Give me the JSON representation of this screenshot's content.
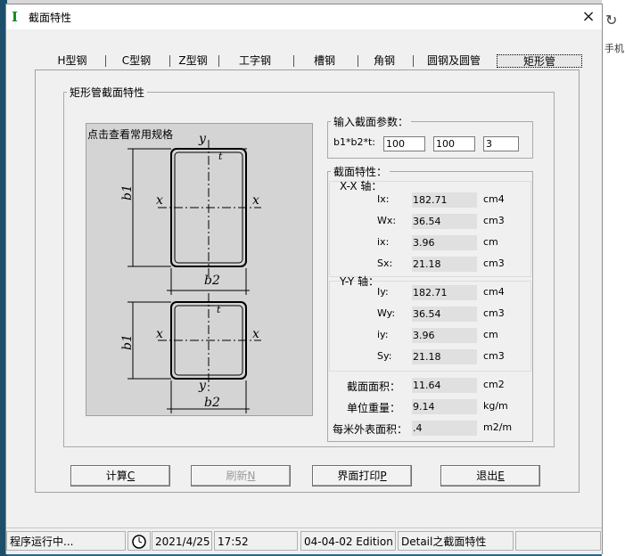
{
  "window": {
    "title": "截面特性",
    "app_icon": "I",
    "close_label": "×"
  },
  "desktop": {
    "right_text": "手机",
    "refresh_glyph": "↻"
  },
  "tabs": [
    {
      "label": "H型钢"
    },
    {
      "label": "C型钢"
    },
    {
      "label": "Z型钢"
    },
    {
      "label": "工字钢"
    },
    {
      "label": "槽钢"
    },
    {
      "label": "角钢"
    },
    {
      "label": "圆钢及圆管"
    },
    {
      "label": "矩形管"
    }
  ],
  "active_tab": "矩形管",
  "section_group": {
    "title": "矩形管截面特性"
  },
  "diagram": {
    "link": "点击查看常用规格",
    "top": {
      "y": "y",
      "x_left": "x",
      "x_right": "x",
      "t": "t",
      "b1": "b1",
      "b2": "b2"
    },
    "bottom": {
      "y": "y",
      "x_left": "x",
      "x_right": "x",
      "t": "t",
      "b1": "b1",
      "b2": "b2"
    }
  },
  "input_group": {
    "title": "输入截面参数：",
    "label": "b1*b2*t:",
    "b1": "100",
    "b2": "100",
    "t": "3"
  },
  "props_group": {
    "title": "截面特性：",
    "xx_title": "X-X 轴：",
    "xx": [
      {
        "name": "Ix:",
        "value": "182.71",
        "unit": "cm4"
      },
      {
        "name": "Wx:",
        "value": "36.54",
        "unit": "cm3"
      },
      {
        "name": "ix:",
        "value": "3.96",
        "unit": "cm"
      },
      {
        "name": "Sx:",
        "value": "21.18",
        "unit": "cm3"
      }
    ],
    "yy_title": "Y-Y 轴：",
    "yy": [
      {
        "name": "Iy:",
        "value": "182.71",
        "unit": "cm4"
      },
      {
        "name": "Wy:",
        "value": "36.54",
        "unit": "cm3"
      },
      {
        "name": "iy:",
        "value": "3.96",
        "unit": "cm"
      },
      {
        "name": "Sy:",
        "value": "21.18",
        "unit": "cm3"
      }
    ],
    "area": {
      "name": "截面面积：",
      "value": "11.64",
      "unit": "cm2"
    },
    "weight": {
      "name": "单位重量：",
      "value": "9.14",
      "unit": "kg/m"
    },
    "surface": {
      "name": "每米外表面积：",
      "value": ".4",
      "unit": "m2/m"
    }
  },
  "buttons": {
    "calc": {
      "text": "计算",
      "key": "C"
    },
    "refresh": {
      "text": "刷新",
      "key": "N"
    },
    "print": {
      "text": "界面打印",
      "key": "P"
    },
    "exit": {
      "text": "退出",
      "key": "E"
    }
  },
  "statusbar": {
    "status": "程序运行中...",
    "date": "2021/4/25",
    "time": "17:52",
    "edition": "04-04-02 Edition",
    "module": "Detail之截面特性"
  }
}
